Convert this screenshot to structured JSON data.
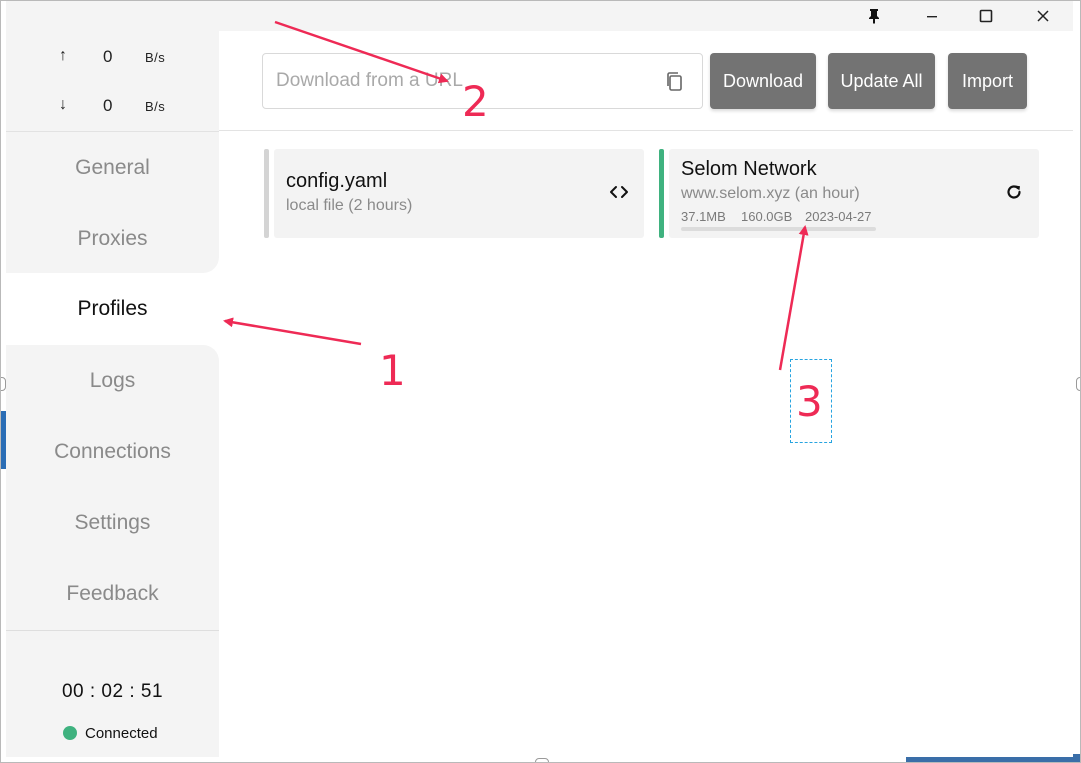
{
  "window": {
    "controls": {
      "pin_icon": "pin-icon",
      "minimize_icon": "minimize-icon",
      "maximize_icon": "maximize-icon",
      "close_icon": "close-icon"
    }
  },
  "sidebar": {
    "traffic": {
      "up": {
        "arrow": "↑",
        "value": "0",
        "unit": "B/s"
      },
      "down": {
        "arrow": "↓",
        "value": "0",
        "unit": "B/s"
      }
    },
    "items": [
      {
        "label": "General",
        "active": false
      },
      {
        "label": "Proxies",
        "active": false
      },
      {
        "label": "Profiles",
        "active": true
      },
      {
        "label": "Logs",
        "active": false
      },
      {
        "label": "Connections",
        "active": false
      },
      {
        "label": "Settings",
        "active": false
      },
      {
        "label": "Feedback",
        "active": false
      }
    ],
    "timer": "00 : 02 : 51",
    "status": {
      "label": "Connected",
      "color": "#3fb27f"
    }
  },
  "toolbar": {
    "url_placeholder": "Download from a URL",
    "url_value": "",
    "download_label": "Download",
    "update_all_label": "Update All",
    "import_label": "Import"
  },
  "profiles": [
    {
      "name": "config.yaml",
      "subtitle": "local file (2 hours)",
      "selected": false,
      "accent": "#d4d4d4",
      "action_icon": "code-icon"
    },
    {
      "name": "Selom Network",
      "subtitle": "www.selom.xyz (an hour)",
      "used": "37.1MB",
      "total": "160.0GB",
      "expire": "2023-04-27",
      "usage_fraction": 0.0002,
      "selected": true,
      "accent": "#3fb27f",
      "action_icon": "refresh-icon"
    }
  ],
  "annotations": {
    "one": "1",
    "two": "2",
    "three": "3",
    "color": "#ee2a55"
  }
}
